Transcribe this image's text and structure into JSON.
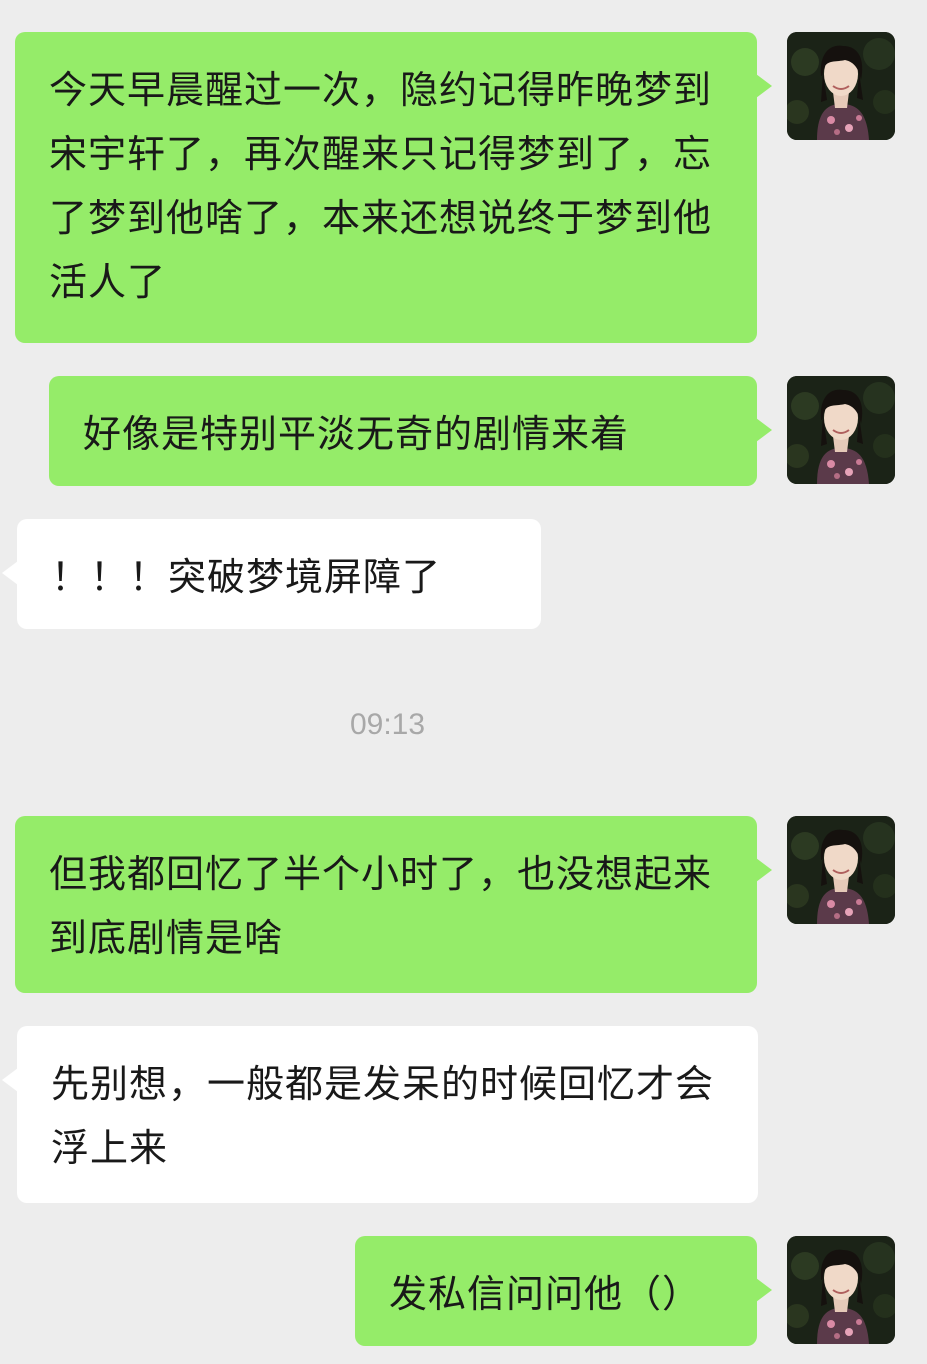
{
  "messages": [
    {
      "direction": "sent",
      "text": "今天早晨醒过一次，隐约记得昨晚梦到宋宇轩了，再次醒来只记得梦到了，忘了梦到他啥了，本来还想说终于梦到他活人了"
    },
    {
      "direction": "sent",
      "text": "好像是特别平淡无奇的剧情来着"
    },
    {
      "direction": "received",
      "text": "！！！突破梦境屏障了"
    },
    {
      "direction": "sent",
      "text": "但我都回忆了半个小时了，也没想起来到底剧情是啥"
    },
    {
      "direction": "received",
      "text": "先别想，一般都是发呆的时候回忆才会浮上来"
    },
    {
      "direction": "sent",
      "text": "发私信问问他（）"
    }
  ],
  "timestamp": "09:13",
  "colors": {
    "background": "#ededed",
    "sent_bubble": "#95ec69",
    "received_bubble": "#ffffff",
    "timestamp_text": "#a8a8a8"
  },
  "icons": {
    "avatar": "user-avatar-photo"
  }
}
